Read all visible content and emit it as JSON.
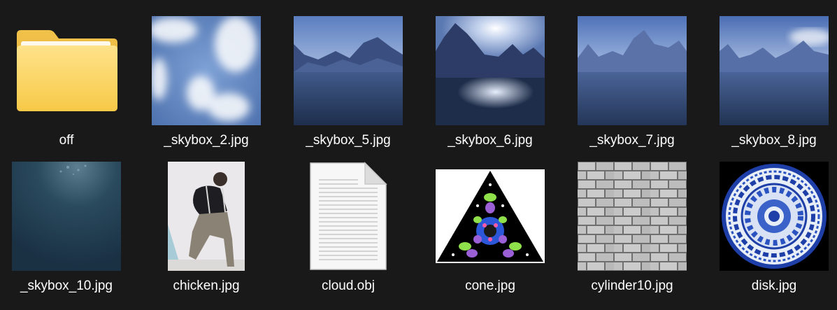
{
  "window": {
    "background": "#191919"
  },
  "items": [
    {
      "name": "off",
      "kind": "folder",
      "icon": "folder-icon"
    },
    {
      "name": "_skybox_2.jpg",
      "kind": "image",
      "icon": "sky-clouds-thumbnail"
    },
    {
      "name": "_skybox_5.jpg",
      "kind": "image",
      "icon": "mountain-lake-thumbnail"
    },
    {
      "name": "_skybox_6.jpg",
      "kind": "image",
      "icon": "mountain-sun-lake-thumbnail"
    },
    {
      "name": "_skybox_7.jpg",
      "kind": "image",
      "icon": "mountain-lake-thumbnail"
    },
    {
      "name": "_skybox_8.jpg",
      "kind": "image",
      "icon": "mountain-lake-thumbnail"
    },
    {
      "name": "_skybox_10.jpg",
      "kind": "image",
      "icon": "deep-water-thumbnail"
    },
    {
      "name": "chicken.jpg",
      "kind": "image",
      "icon": "dancing-person-thumbnail"
    },
    {
      "name": "cloud.obj",
      "kind": "file",
      "icon": "document-icon"
    },
    {
      "name": "cone.jpg",
      "kind": "image",
      "icon": "triangle-pattern-thumbnail"
    },
    {
      "name": "cylinder10.jpg",
      "kind": "image",
      "icon": "brick-wall-thumbnail"
    },
    {
      "name": "disk.jpg",
      "kind": "image",
      "icon": "porcelain-plate-thumbnail"
    }
  ]
}
